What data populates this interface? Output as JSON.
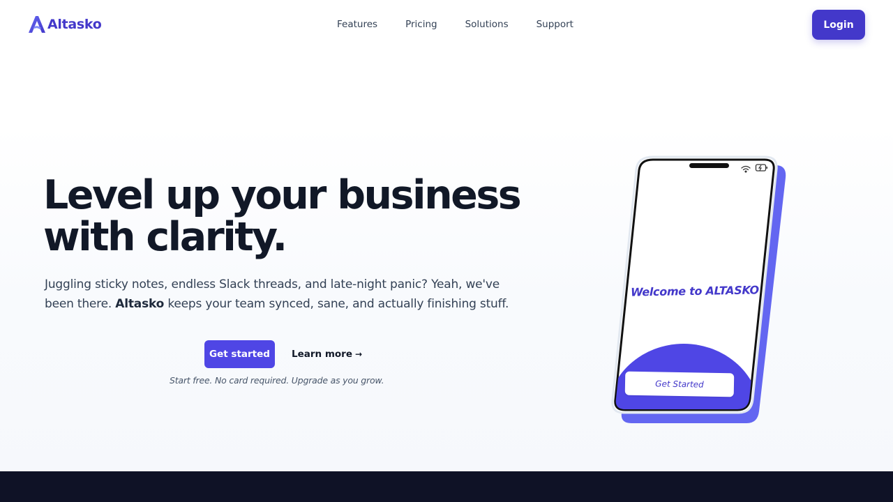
{
  "brand": {
    "name": "Altasko",
    "primary_color": "#4338ca",
    "accent_color": "#4f46e5",
    "logo_icon": "a-logo-icon"
  },
  "nav": {
    "items": [
      {
        "label": "Features"
      },
      {
        "label": "Pricing"
      },
      {
        "label": "Solutions"
      },
      {
        "label": "Support"
      }
    ],
    "login_label": "Login"
  },
  "hero": {
    "title_line1": "Level up your business",
    "title_line2": "with clarity.",
    "subtitle_part1": "Juggling sticky notes, endless Slack threads, and late-night panic? Yeah, we've been there. ",
    "subtitle_brand": "Altasko",
    "subtitle_part2": " keeps your team synced, sane, and actually finishing stuff.",
    "primary_cta": "Get started",
    "secondary_cta": "Learn more",
    "secondary_cta_icon": "arrow-right-icon",
    "note": "Start free. No card required. Upgrade as you grow."
  },
  "phone": {
    "welcome_text": "Welcome to ALTASKO",
    "button_label": "Get Started",
    "status_icons": [
      "wifi-icon",
      "battery-charging-icon"
    ]
  }
}
